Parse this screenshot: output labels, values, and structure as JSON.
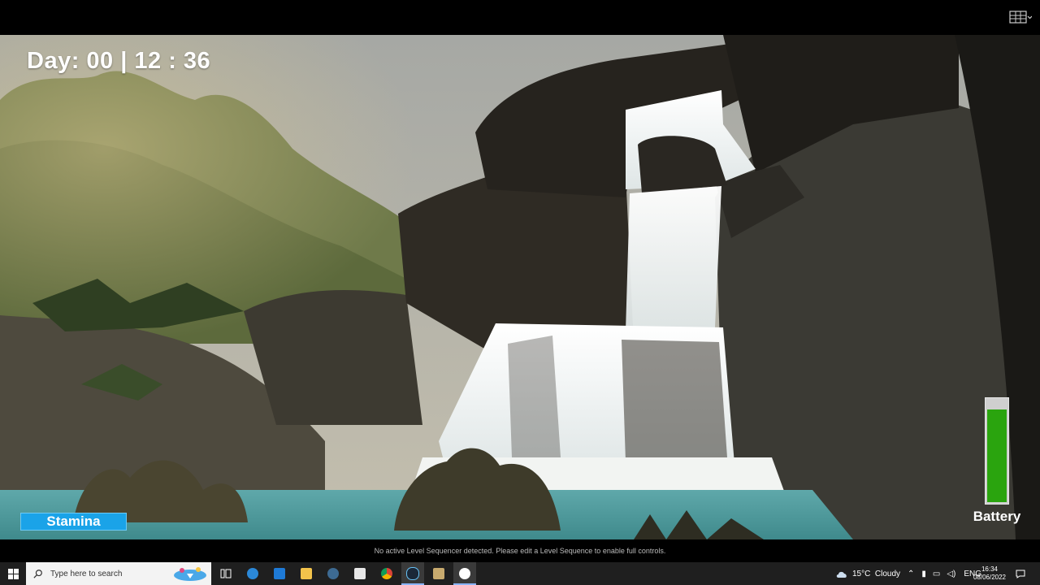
{
  "hud": {
    "time_text": "Day: 00 | 12 : 36",
    "stamina_label": "Stamina",
    "battery_label": "Battery",
    "battery_level": 0.91
  },
  "viewport_message": "No active Level Sequencer detected. Please edit a Level Sequence to enable full controls.",
  "taskbar": {
    "search_placeholder": "Type here to search",
    "apps": [
      "start-icon",
      "task-view-icon",
      "edge-icon",
      "mail-icon",
      "file-explorer-icon",
      "steam-icon",
      "store-icon",
      "chrome-icon",
      "steam-icon-2",
      "league-icon",
      "unreal-engine-icon"
    ],
    "weather": "15°C  Cloudy",
    "language": "ENG",
    "time": "16:34",
    "date": "08/06/2022"
  },
  "colors": {
    "stamina": "#1aa3e8",
    "battery_fill": "#2aa40e",
    "taskbar": "#1f1f1f"
  }
}
